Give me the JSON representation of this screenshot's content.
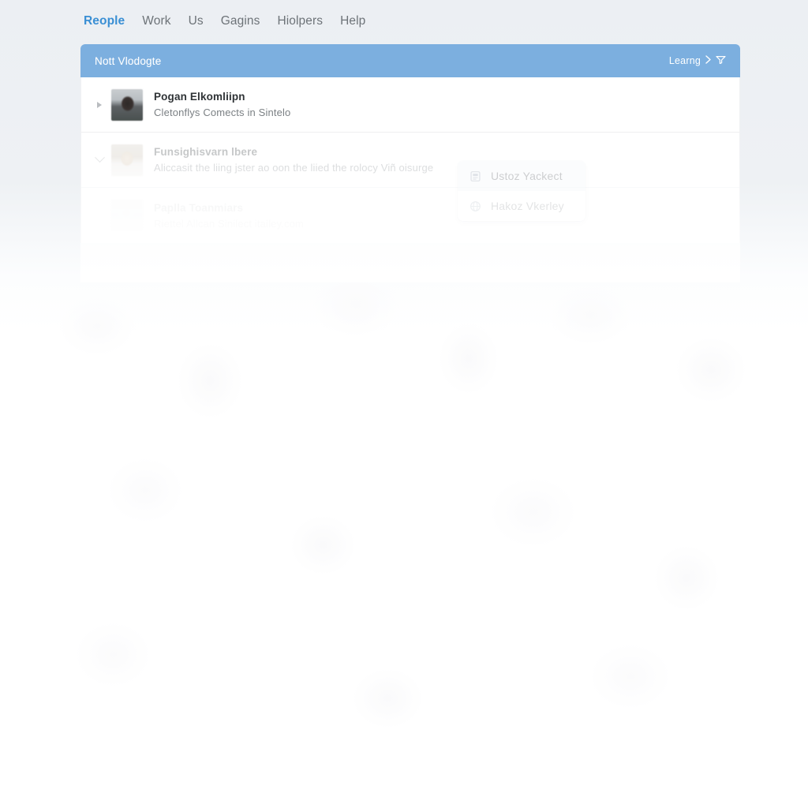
{
  "nav": {
    "items": [
      {
        "label": "Reople",
        "active": true
      },
      {
        "label": "Work",
        "active": false
      },
      {
        "label": "Us",
        "active": false
      },
      {
        "label": "Gagins",
        "active": false
      },
      {
        "label": "Hiolpers",
        "active": false
      },
      {
        "label": "Help",
        "active": false
      }
    ]
  },
  "card": {
    "header": {
      "title": "Nott Vlodogte",
      "action_label": "Learng",
      "chevron_icon": "chevron-right-icon",
      "filter_icon": "filter-icon"
    },
    "rows": [
      {
        "expander_icon": "triangle-right-icon",
        "avatar": "avatar-photo",
        "title": "Pogan Elkomliipn",
        "subtitle": "Cletonflys Comects in Sintelo"
      },
      {
        "expander_icon": "chevron-down-icon",
        "avatar": "avatar-photo",
        "title": "Funsighisvarn lbere",
        "subtitle": "Aliccasit the liing jster ao oon the liied the rolocy Viñ oisurge"
      },
      {
        "expander_icon": "",
        "avatar": "avatar-photo",
        "title": "Paplla Toanmiars",
        "subtitle": "Riettel Allcan Sinilect itailey.com"
      }
    ]
  },
  "context_menu": {
    "items": [
      {
        "icon": "document-icon",
        "label": "Ustoz Yackect"
      },
      {
        "icon": "globe-icon",
        "label": "Hakoz Vkerley"
      }
    ]
  },
  "colors": {
    "accent": "#3a8fd4",
    "header_bar": "#7cafdf",
    "page_bg": "#eceff3",
    "card_bg": "#ffffff",
    "text_primary": "#2f3336",
    "text_secondary": "#7b8084"
  }
}
